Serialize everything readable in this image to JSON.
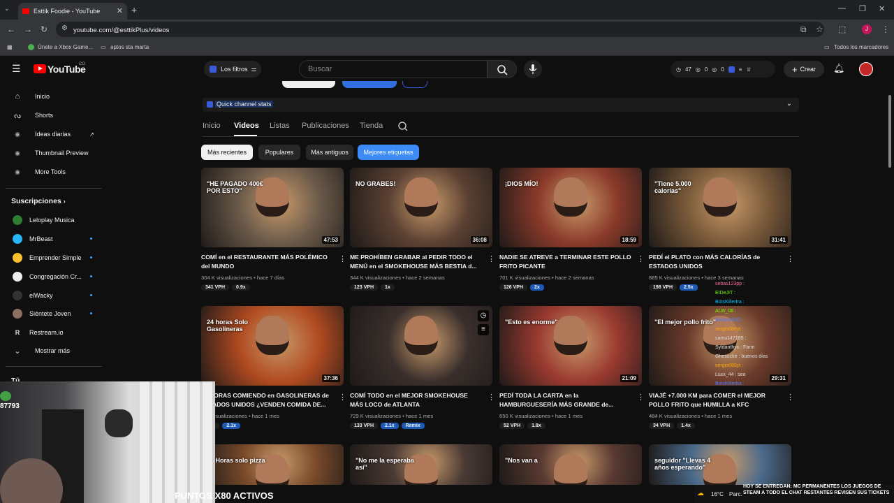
{
  "browser": {
    "tab_title": "Esttik Foodie - YouTube",
    "url": "youtube.com/@esttikPlus/videos",
    "bookmarks": [
      "Únete a Xbox Game...",
      "aptos sta marta"
    ],
    "bookmarks_right": "Todos los marcadores"
  },
  "header": {
    "logo": "YouTube",
    "logo_country": "CO",
    "filters_label": "Los filtros",
    "search_placeholder": "Buscar",
    "stats": [
      "47",
      "0",
      "0"
    ],
    "create_label": "Crear"
  },
  "sidebar": {
    "items": [
      {
        "label": "Inicio",
        "icon": "home-icon"
      },
      {
        "label": "Shorts",
        "icon": "shorts-icon"
      },
      {
        "label": "Ideas diarias",
        "icon": "ideas-icon"
      },
      {
        "label": "Thumbnail Preview",
        "icon": "thumbnail-icon"
      },
      {
        "label": "More Tools",
        "icon": "tools-icon"
      }
    ],
    "subscriptions_title": "Suscripciones",
    "subscriptions": [
      {
        "label": "Leloplay Musica",
        "dot": false,
        "color": "#2e7d32"
      },
      {
        "label": "MrBeast",
        "dot": true,
        "color": "#29b6f6"
      },
      {
        "label": "Emprender Simple",
        "dot": true,
        "color": "#fbc02d"
      },
      {
        "label": "Congregación Cr...",
        "dot": true,
        "color": "#eeeeee"
      },
      {
        "label": "elWacky",
        "dot": true,
        "color": "#333333"
      },
      {
        "label": "Siéntete Joven",
        "dot": true,
        "color": "#8d6e63"
      },
      {
        "label": "Restream.io",
        "dot": false,
        "color": "#111111"
      }
    ],
    "show_more": "Mostrar más",
    "you_label": "Tú"
  },
  "channel": {
    "quick_stats": "Quick channel stats",
    "tabs": [
      "Inicio",
      "Videos",
      "Listas",
      "Publicaciones",
      "Tienda"
    ],
    "active_tab": "Videos",
    "chips": [
      "Más recientes",
      "Populares",
      "Más antiguos",
      "Mejores etiquetas"
    ]
  },
  "videos": [
    {
      "title": "COMÍ en el RESTAURANTE MÁS POLÉMICO del MUNDO",
      "meta": "304 K visualizaciones • hace 7 días",
      "duration": "47:53",
      "badges": [
        "341 VPH",
        "0.9x"
      ],
      "thumb_text": "\"HE PAGADO 400€ POR ESTO\"",
      "color": "#6b5a4a"
    },
    {
      "title": "ME PROHÍBEN GRABAR al PEDIR TODO el MENÚ en el SMOKEHOUSE MÁS BESTIA d...",
      "meta": "344 K visualizaciones • hace 2 semanas",
      "duration": "36:08",
      "badges": [
        "123 VPH",
        "1x"
      ],
      "thumb_text": "NO GRABES!",
      "color": "#5a4032"
    },
    {
      "title": "NADIE SE ATREVE a TERMINAR ESTE POLLO FRITO PICANTE",
      "meta": "701 K visualizaciones • hace 2 semanas",
      "duration": "18:59",
      "badges": [
        "126 VPH",
        "2x"
      ],
      "thumb_text": "¡DIOS MÍO!",
      "color": "#8a3a2a"
    },
    {
      "title": "PEDÍ el PLATO con MÁS CALORÍAS de ESTADOS UNIDOS",
      "meta": "885 K visualizaciones • hace 3 semanas",
      "duration": "31:41",
      "badges": [
        "198 VPH",
        "2.5x"
      ],
      "thumb_text": "\"Tiene 5.000 calorías\"",
      "color": "#7a5a3a"
    },
    {
      "title": "24 HORAS COMIENDO en GASOLINERAS de ESTADOS UNIDOS ¿VENDEN COMIDA DE...",
      "meta": "2 M visualizaciones • hace 1 mes",
      "duration": "37:36",
      "badges": [
        "VPH",
        "2.1x"
      ],
      "thumb_text": "24 horas Solo Gasolineras",
      "color": "#b04a20"
    },
    {
      "title": "COMÍ TODO en el MEJOR SMOKEHOUSE MÁS LOCO de ATLANTA",
      "meta": "729 K visualizaciones • hace 1 mes",
      "duration": "",
      "badges": [
        "133 VPH",
        "2.1x",
        "Remix"
      ],
      "thumb_text": "",
      "color": "#3a2f2c"
    },
    {
      "title": "PEDÍ TODA LA CARTA en la HAMBURGUESERÍA MÁS GRANDE de...",
      "meta": "650 K visualizaciones • hace 1 mes",
      "duration": "21:09",
      "badges": [
        "52 VPH",
        "1.8x"
      ],
      "thumb_text": "\"Esto es enorme\"",
      "color": "#9a3a30"
    },
    {
      "title": "VIAJÉ +7.000 KM para COMER el MEJOR POLLO FRITO que HUMILLA a KFC",
      "meta": "484 K visualizaciones • hace 1 mes",
      "duration": "29:31",
      "badges": [
        "34 VPH",
        "1.4x"
      ],
      "thumb_text": "\"El mejor pollo frito\"",
      "color": "#6a3a2a"
    },
    {
      "title": "",
      "meta": "",
      "duration": "",
      "badges": [],
      "thumb_text": "24 Horas solo pizza",
      "color": "#7a4a2a"
    },
    {
      "title": "",
      "meta": "",
      "duration": "",
      "badges": [],
      "thumb_text": "\"No me la esperaba así\"",
      "color": "#4a3a34"
    },
    {
      "title": "",
      "meta": "",
      "duration": "",
      "badges": [],
      "thumb_text": "\"Nos van a",
      "color": "#5a3a32"
    },
    {
      "title": "",
      "meta": "",
      "duration": "",
      "badges": [],
      "thumb_text": "seguidor \"Llevas 4 años esperando\"",
      "color": "#4a6a8a"
    }
  ],
  "overlay": {
    "stream_counter": "87793",
    "ticker": "PUNTOS X80 ACTIVOS",
    "chat": [
      "sebas123pp :",
      "EIDeJIT :",
      "BotsKillertra :",
      "ALW_08 :",
      "AlvAroHDG :",
      "sergio086yt :",
      "samu147165 :",
      "Syldanthys : Farm",
      "Ghesucke : buenos días",
      "sergio086yt :",
      "Luxx_44 : see",
      "BotsKillertra :"
    ],
    "taskbar_temp": "16°C",
    "taskbar_weather": "Parc.",
    "notice": "HOY SE ENTREGAN: MC PERMANENTES LOS JUEGOS DE STEAM A TODO EL CHAT RESTANTES REVISEN SUS TICKETS"
  }
}
